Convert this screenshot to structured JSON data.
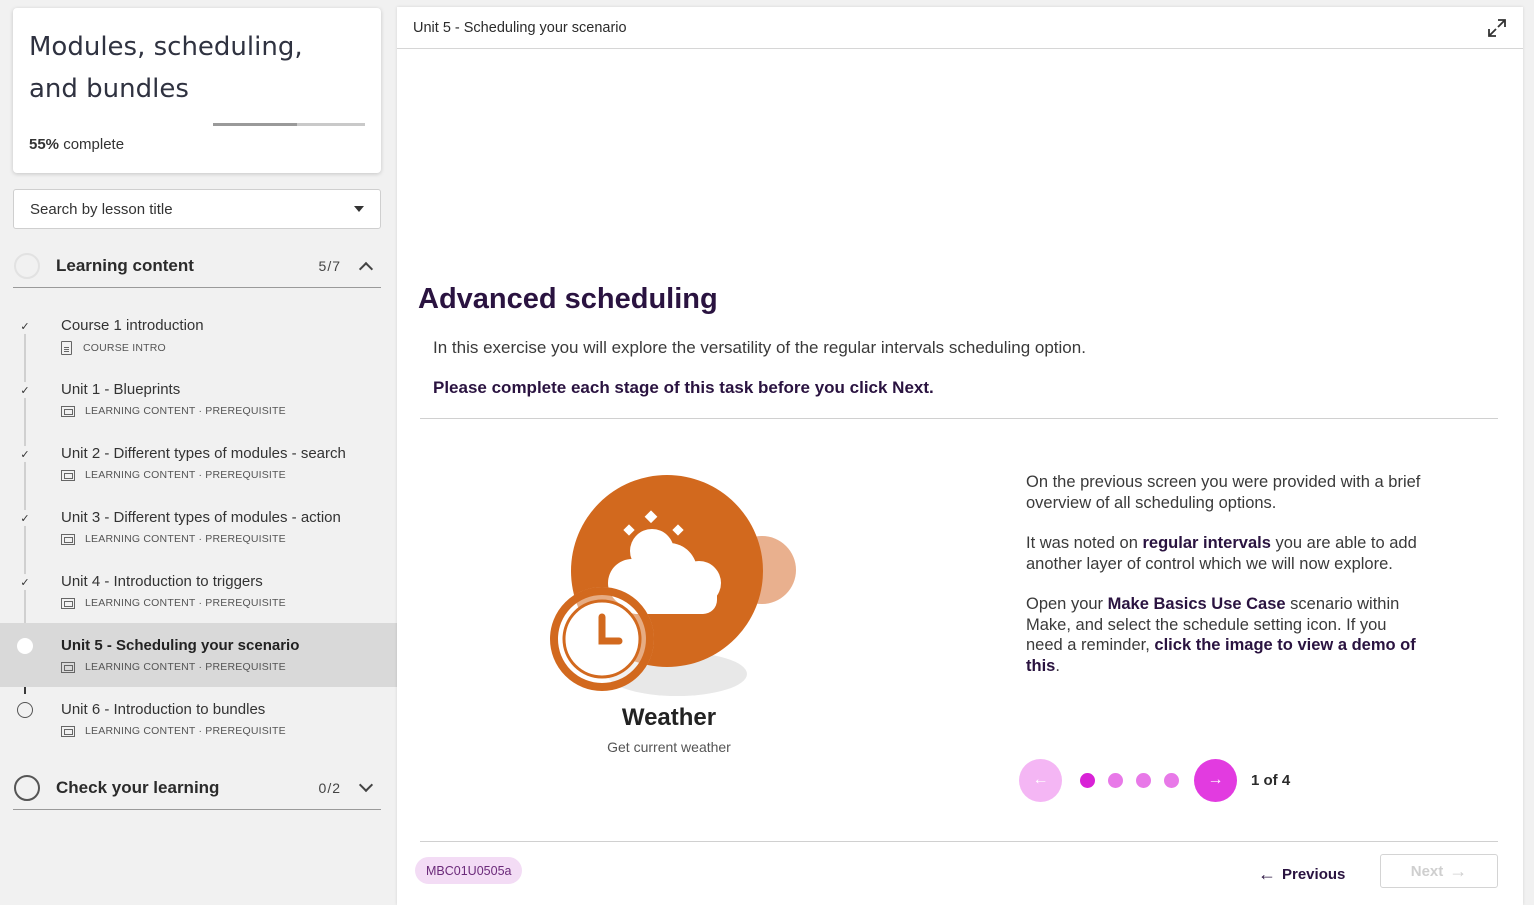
{
  "sidebar": {
    "course_title": "Modules, scheduling, and bundles",
    "progress_percent": 55,
    "progress_value": "55%",
    "progress_suffix": "complete",
    "search_placeholder": "Search by lesson title",
    "sections": [
      {
        "label": "Learning content",
        "count": "5/7",
        "expanded": true
      },
      {
        "label": "Check your learning",
        "count": "0/2",
        "expanded": false
      }
    ],
    "lessons": [
      {
        "title": "Course 1 introduction",
        "meta": "COURSE INTRO",
        "icon": "document-icon",
        "status": "complete"
      },
      {
        "title": "Unit 1 - Blueprints",
        "meta": "LEARNING CONTENT · PREREQUISITE",
        "icon": "presentation-icon",
        "status": "complete"
      },
      {
        "title": "Unit 2 - Different types of modules - search",
        "meta": "LEARNING CONTENT · PREREQUISITE",
        "icon": "presentation-icon",
        "status": "complete"
      },
      {
        "title": "Unit 3 - Different types of modules - action",
        "meta": "LEARNING CONTENT · PREREQUISITE",
        "icon": "presentation-icon",
        "status": "complete"
      },
      {
        "title": "Unit 4 - Introduction to triggers",
        "meta": "LEARNING CONTENT · PREREQUISITE",
        "icon": "presentation-icon",
        "status": "complete"
      },
      {
        "title": "Unit 5 - Scheduling your scenario",
        "meta": "LEARNING CONTENT · PREREQUISITE",
        "icon": "presentation-icon",
        "status": "current"
      },
      {
        "title": "Unit 6 - Introduction to bundles",
        "meta": "LEARNING CONTENT · PREREQUISITE",
        "icon": "presentation-icon",
        "status": "not-started"
      }
    ]
  },
  "main": {
    "breadcrumb": "Unit 5 - Scheduling your scenario",
    "heading": "Advanced scheduling",
    "intro": "In this exercise you will explore the versatility of the regular intervals scheduling option.",
    "instruction": "Please complete each stage of this task before you click Next.",
    "module": {
      "title": "Weather",
      "subtitle": "Get current weather"
    },
    "panel_text": {
      "p1": "On the previous screen you were provided with a brief overview of all scheduling options.",
      "p2_pre": "It was noted on ",
      "p2_bold": "regular intervals",
      "p2_post": " you are able to add another layer of control which we will now explore.",
      "p3_pre": "Open your ",
      "p3_bold1": "Make Basics Use Case",
      "p3_mid": " scenario within Make, and select the schedule setting icon. If you need a reminder, ",
      "p3_bold2": "click the image to view a demo of this",
      "p3_end": "."
    },
    "carousel": {
      "current": 1,
      "total": 4,
      "label": "1 of 4"
    },
    "footer": {
      "code": "MBC01U0505a",
      "previous_label": "Previous",
      "next_label": "Next"
    }
  },
  "colors": {
    "heading": "#2a1340",
    "accent": "#e23be0",
    "accent_light": "#f4b6f4",
    "weather_orange": "#d2691e",
    "badge_bg": "#f3dcf5"
  }
}
